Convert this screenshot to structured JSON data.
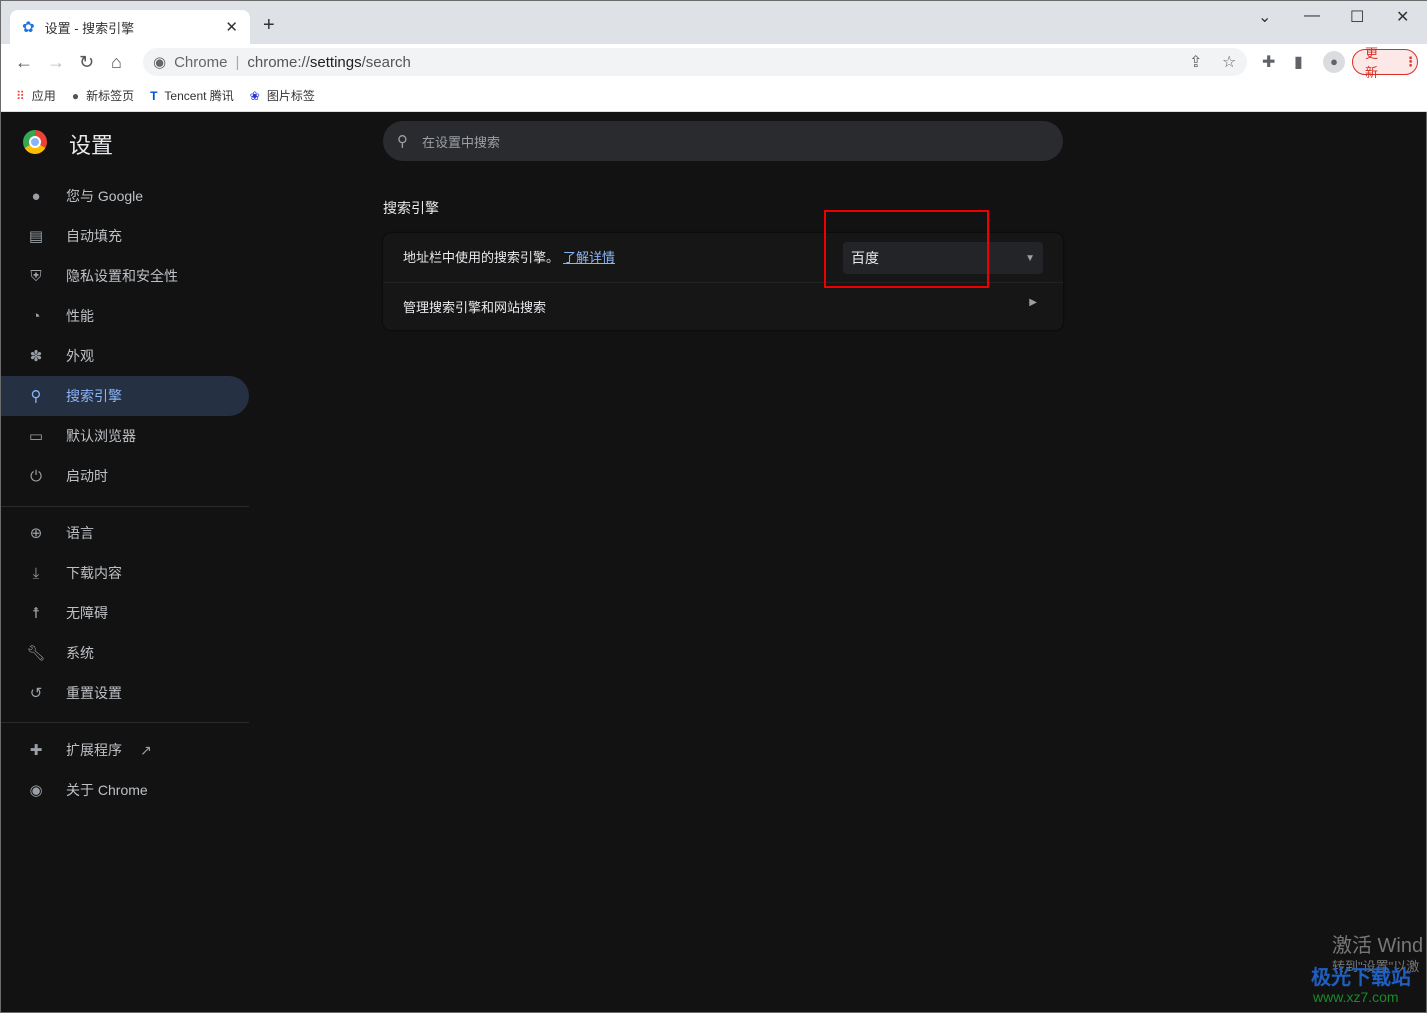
{
  "window": {
    "tab_title": "设置 - 搜索引擎",
    "new_tab": "+",
    "controls": [
      "⌄",
      "—",
      "☐",
      "✕"
    ]
  },
  "toolbar": {
    "omnibox_label": "Chrome",
    "url_prefix": "chrome://",
    "url_host": "settings",
    "url_path": "/search",
    "update_label": "更新"
  },
  "bookmarks": [
    {
      "label": "应用",
      "icon": "apps-grid-icon"
    },
    {
      "label": "新标签页",
      "icon": "globe-icon"
    },
    {
      "label": "Tencent 腾讯",
      "icon": "tencent-icon"
    },
    {
      "label": "图片标签",
      "icon": "baidu-paw-icon"
    }
  ],
  "sidebar": {
    "title": "设置",
    "items": [
      {
        "label": "您与 Google",
        "icon": "person-icon"
      },
      {
        "label": "自动填充",
        "icon": "clipboard-icon"
      },
      {
        "label": "隐私设置和安全性",
        "icon": "shield-icon"
      },
      {
        "label": "性能",
        "icon": "gauge-icon"
      },
      {
        "label": "外观",
        "icon": "palette-icon"
      },
      {
        "label": "搜索引擎",
        "icon": "search-icon",
        "active": true
      },
      {
        "label": "默认浏览器",
        "icon": "browser-icon"
      },
      {
        "label": "启动时",
        "icon": "power-icon"
      },
      {
        "label": "语言",
        "icon": "globe-icon"
      },
      {
        "label": "下载内容",
        "icon": "download-icon"
      },
      {
        "label": "无障碍",
        "icon": "accessibility-icon"
      },
      {
        "label": "系统",
        "icon": "wrench-icon"
      },
      {
        "label": "重置设置",
        "icon": "history-icon"
      },
      {
        "label": "扩展程序",
        "icon": "puzzle-icon"
      },
      {
        "label": "关于 Chrome",
        "icon": "chrome-icon"
      }
    ]
  },
  "main": {
    "search_placeholder": "在设置中搜索",
    "section_title": "搜索引擎",
    "engine_label": "地址栏中使用的搜索引擎。",
    "learn_more": "了解详情",
    "engine_value": "百度",
    "manage_label": "管理搜索引擎和网站搜索"
  },
  "watermark": {
    "activate": "激活 Wind",
    "activate_sub": "转到\"设置\"以激",
    "site_name": "极光下载站",
    "site_url": "www.xz7.com"
  },
  "colors": {
    "accent": "#8ab4f8",
    "highlight_box": "#e00000",
    "update": "#d93025"
  }
}
